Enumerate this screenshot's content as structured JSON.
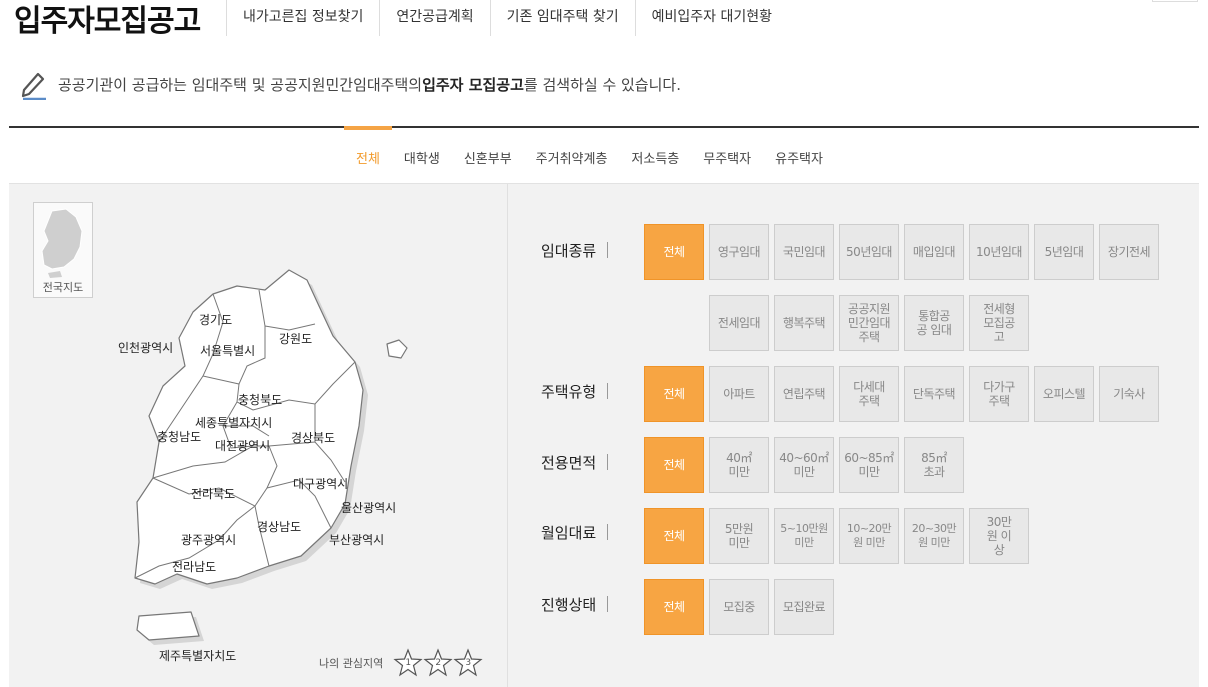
{
  "header": {
    "title": "입주자모집공고",
    "nav": [
      "내가고른집 정보찾기",
      "연간공급계획",
      "기존 임대주택 찾기",
      "예비입주자 대기현황"
    ]
  },
  "notice": {
    "prefix": "공공기관이 공급하는 임대주택 및 공공지원민간임대주택의 ",
    "highlight": "입주자 모집공고",
    "suffix": "를 검색하실 수 있습니다."
  },
  "tabs": [
    "전체",
    "대학생",
    "신혼부부",
    "주거취약계층",
    "저소득층",
    "무주택자",
    "유주택자"
  ],
  "active_tab": "전체",
  "map": {
    "overview_label": "전국지도",
    "regions": [
      "경기도",
      "인천광역시",
      "서울특별시",
      "강원도",
      "충청북도",
      "세종특별자치시",
      "충청남도",
      "대전광역시",
      "경상북도",
      "대구광역시",
      "전라북도",
      "울산광역시",
      "경상남도",
      "광주광역시",
      "부산광역시",
      "전라남도",
      "제주특별자치도"
    ],
    "interest_label": "나의 관심지역",
    "interest_stars": [
      "1",
      "2",
      "3"
    ]
  },
  "filters": {
    "rental_type": {
      "label": "임대종류",
      "options": [
        "전체",
        "영구임대",
        "국민임대",
        "50년임대",
        "매입임대",
        "10년임대",
        "5년임대",
        "장기전세",
        "전세임대",
        "행복주택",
        "공공지원 민간임대 주택",
        "통합공공 임대",
        "전세형 모집공고"
      ],
      "selected": "전체"
    },
    "housing_type": {
      "label": "주택유형",
      "options": [
        "전체",
        "아파트",
        "연립주택",
        "다세대 주택",
        "단독주택",
        "다가구 주택",
        "오피스텔",
        "기숙사"
      ],
      "selected": "전체"
    },
    "area": {
      "label": "전용면적",
      "options": [
        "전체",
        "40㎡ 미만",
        "40~60㎡ 미만",
        "60~85㎡ 미만",
        "85㎡ 초과"
      ],
      "selected": "전체"
    },
    "rent": {
      "label": "월임대료",
      "options": [
        "전체",
        "5만원 미만",
        "5~10만원 미만",
        "10~20만원 미만",
        "20~30만원 미만",
        "30만원 이상"
      ],
      "selected": "전체"
    },
    "status": {
      "label": "진행상태",
      "options": [
        "전체",
        "모집중",
        "모집완료"
      ],
      "selected": "전체"
    }
  },
  "colors": {
    "accent": "#f7a543",
    "accent_text": "#f29b2c"
  }
}
